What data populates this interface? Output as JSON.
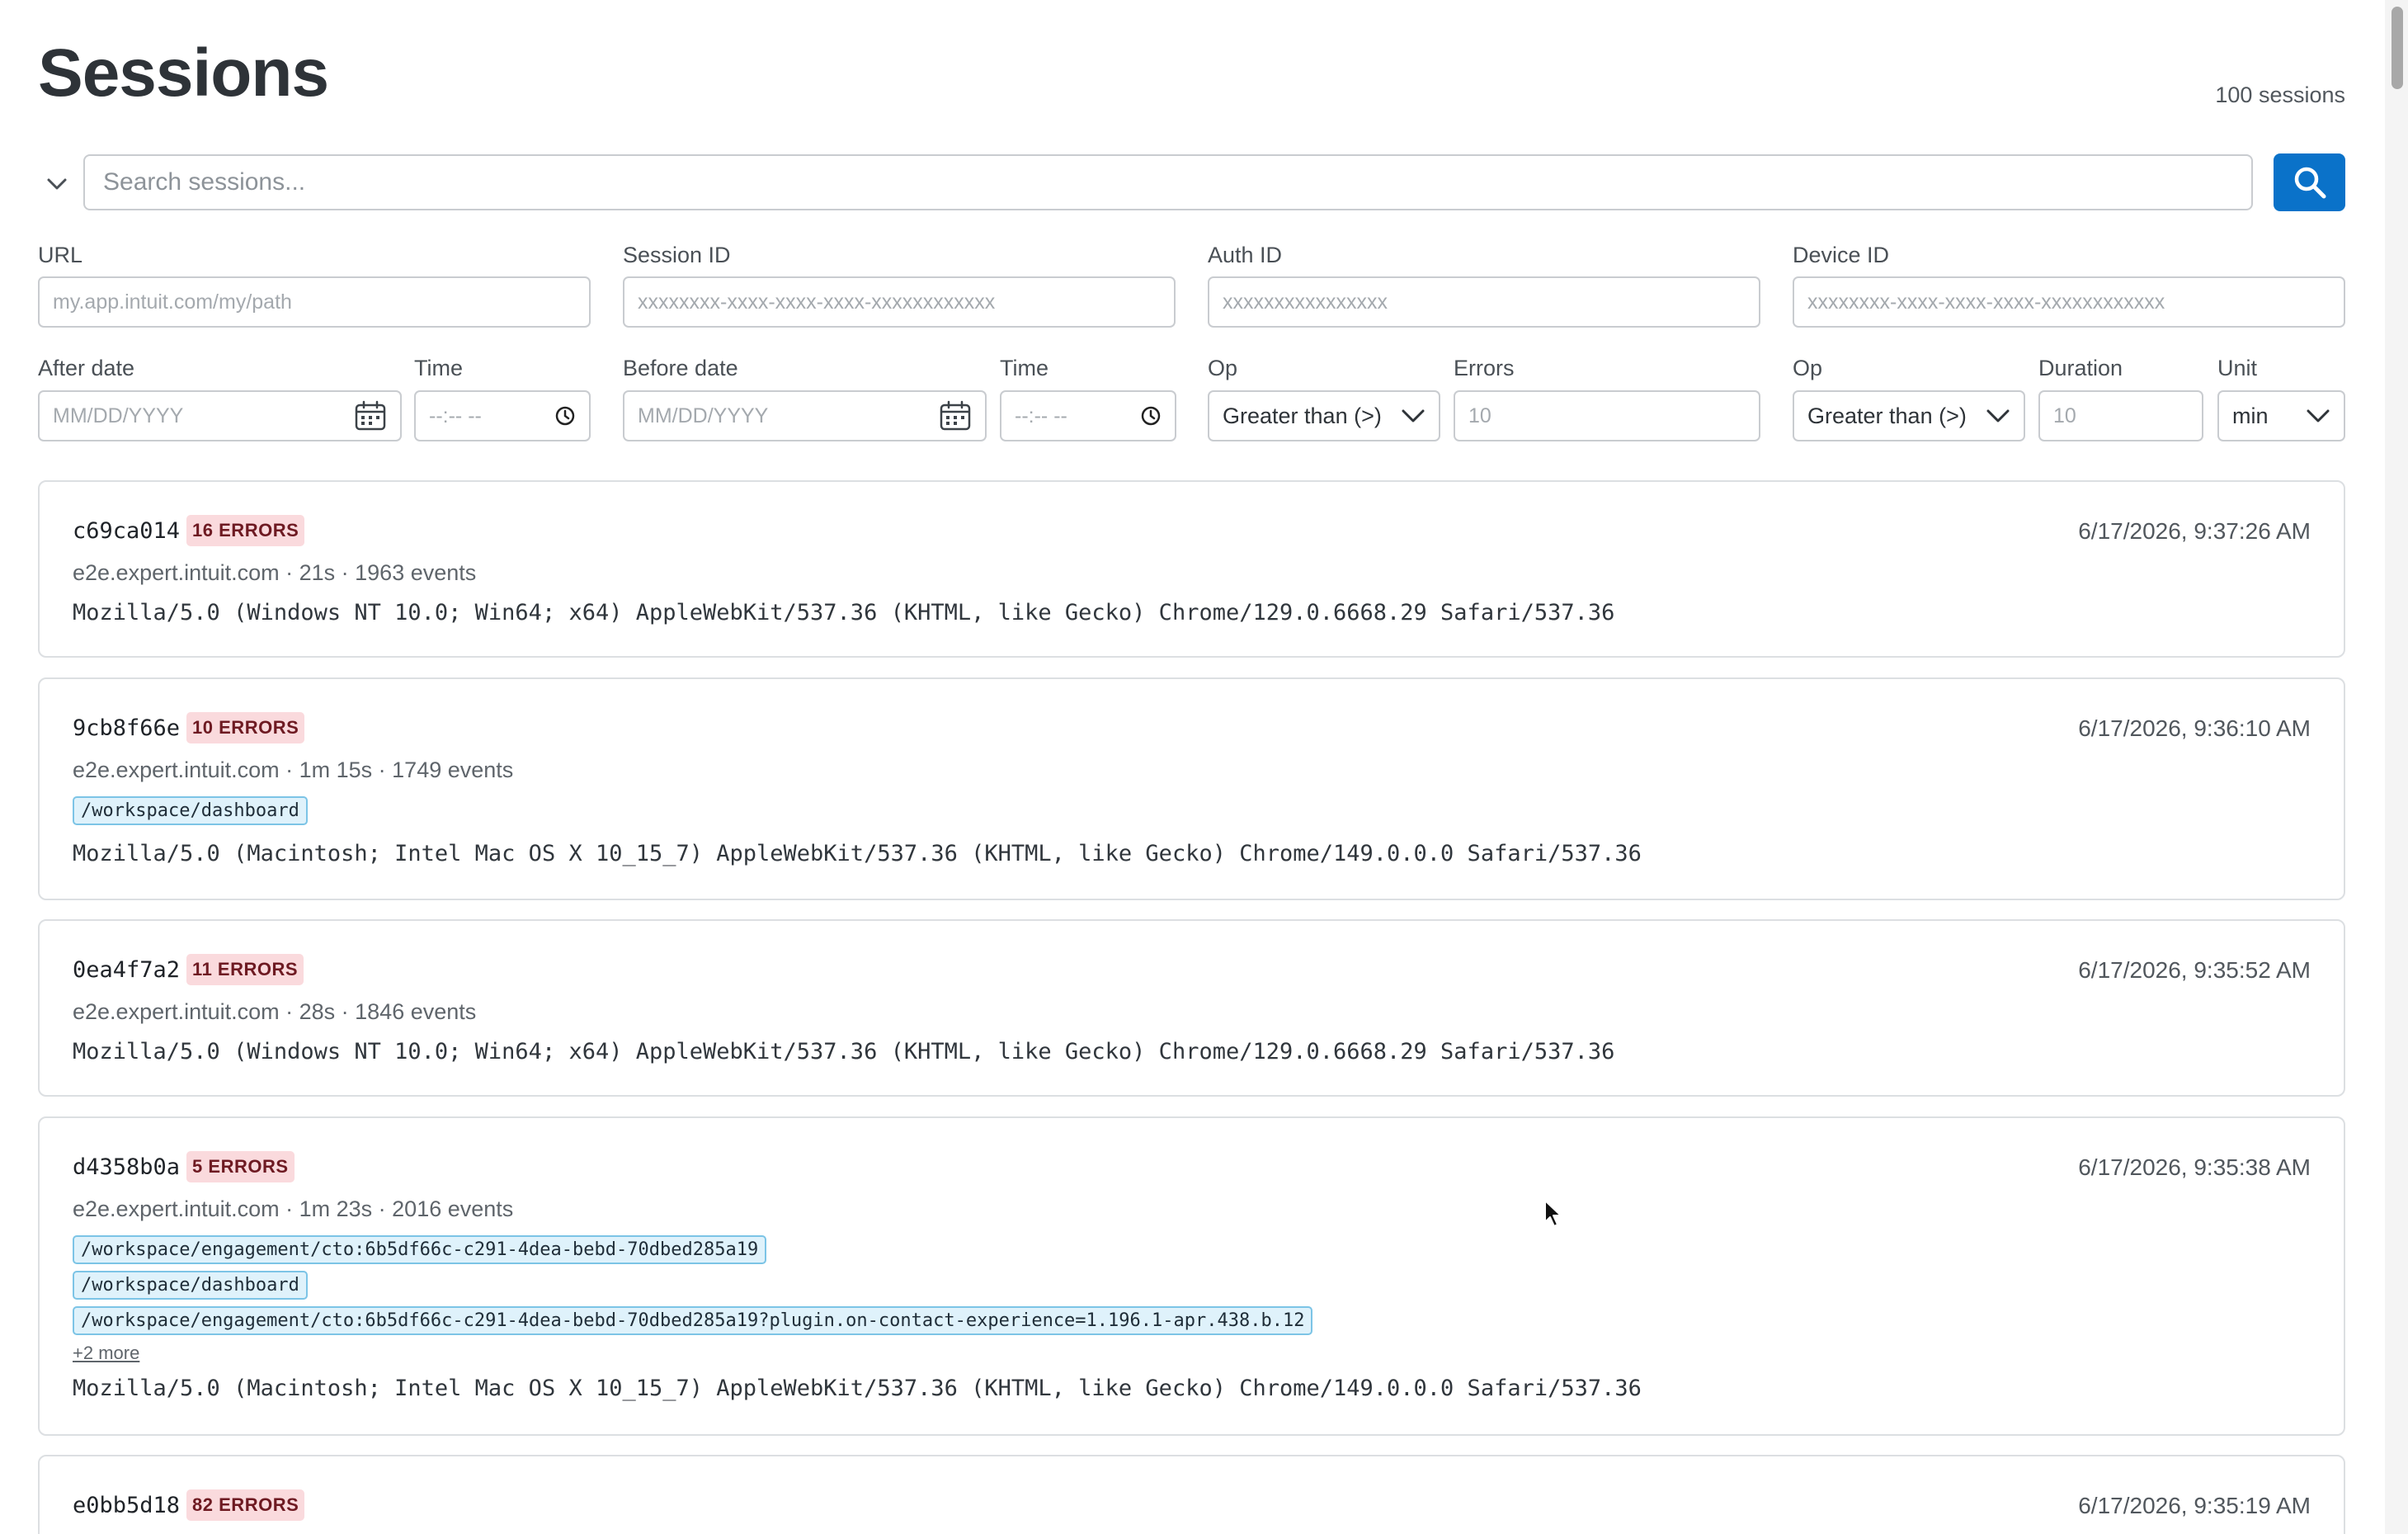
{
  "header": {
    "title": "Sessions",
    "count": "100 sessions"
  },
  "search": {
    "placeholder": "Search sessions..."
  },
  "filters": {
    "url": {
      "label": "URL",
      "placeholder": "my.app.intuit.com/my/path"
    },
    "session_id": {
      "label": "Session ID",
      "placeholder": "xxxxxxxx-xxxx-xxxx-xxxx-xxxxxxxxxxxx"
    },
    "auth_id": {
      "label": "Auth ID",
      "placeholder": "xxxxxxxxxxxxxxxx"
    },
    "device_id": {
      "label": "Device ID",
      "placeholder": "xxxxxxxx-xxxx-xxxx-xxxx-xxxxxxxxxxxx"
    },
    "after_date": {
      "label": "After date",
      "placeholder": "MM/DD/YYYY"
    },
    "after_time": {
      "label": "Time",
      "placeholder": "--:-- --"
    },
    "before_date": {
      "label": "Before date",
      "placeholder": "MM/DD/YYYY"
    },
    "before_time": {
      "label": "Time",
      "placeholder": "--:-- --"
    },
    "errors_op": {
      "label": "Op",
      "value": "Greater than (>)"
    },
    "errors": {
      "label": "Errors",
      "placeholder": "10"
    },
    "duration_op": {
      "label": "Op",
      "value": "Greater than (>)"
    },
    "duration": {
      "label": "Duration",
      "placeholder": "10"
    },
    "unit": {
      "label": "Unit",
      "value": "min"
    }
  },
  "sessions": [
    {
      "id": "c69ca014",
      "errors": "16 ERRORS",
      "timestamp": "6/17/2026, 9:37:26 AM",
      "meta": "e2e.expert.intuit.com · 21s · 1963 events",
      "user_agent": "Mozilla/5.0 (Windows NT 10.0; Win64; x64) AppleWebKit/537.36 (KHTML, like Gecko) Chrome/129.0.6668.29 Safari/537.36"
    },
    {
      "id": "9cb8f66e",
      "errors": "10 ERRORS",
      "timestamp": "6/17/2026, 9:36:10 AM",
      "meta": "e2e.expert.intuit.com · 1m 15s · 1749 events",
      "paths": [
        "/workspace/dashboard"
      ],
      "user_agent": "Mozilla/5.0 (Macintosh; Intel Mac OS X 10_15_7) AppleWebKit/537.36 (KHTML, like Gecko) Chrome/149.0.0.0 Safari/537.36"
    },
    {
      "id": "0ea4f7a2",
      "errors": "11 ERRORS",
      "timestamp": "6/17/2026, 9:35:52 AM",
      "meta": "e2e.expert.intuit.com · 28s · 1846 events",
      "user_agent": "Mozilla/5.0 (Windows NT 10.0; Win64; x64) AppleWebKit/537.36 (KHTML, like Gecko) Chrome/129.0.6668.29 Safari/537.36"
    },
    {
      "id": "d4358b0a",
      "errors": "5 ERRORS",
      "timestamp": "6/17/2026, 9:35:38 AM",
      "meta": "e2e.expert.intuit.com · 1m 23s · 2016 events",
      "paths": [
        "/workspace/engagement/cto:6b5df66c-c291-4dea-bebd-70dbed285a19",
        "/workspace/dashboard",
        "/workspace/engagement/cto:6b5df66c-c291-4dea-bebd-70dbed285a19?plugin.on-contact-experience=1.196.1-apr.438.b.12"
      ],
      "more": "+2 more",
      "user_agent": "Mozilla/5.0 (Macintosh; Intel Mac OS X 10_15_7) AppleWebKit/537.36 (KHTML, like Gecko) Chrome/149.0.0.0 Safari/537.36"
    },
    {
      "id": "e0bb5d18",
      "errors": "82 ERRORS",
      "timestamp": "6/17/2026, 9:35:19 AM"
    }
  ],
  "colors": {
    "accent": "#0a72c9",
    "error_badge_bg": "#fadadd",
    "error_badge_text": "#6e1a22",
    "path_tag_bg": "#dff2fb",
    "path_tag_border": "#7cc4e6"
  },
  "icons": {
    "toggle": "chevron-down-icon",
    "search": "search-icon",
    "date": "calendar-icon",
    "time": "clock-icon",
    "select": "chevron-down-icon"
  }
}
